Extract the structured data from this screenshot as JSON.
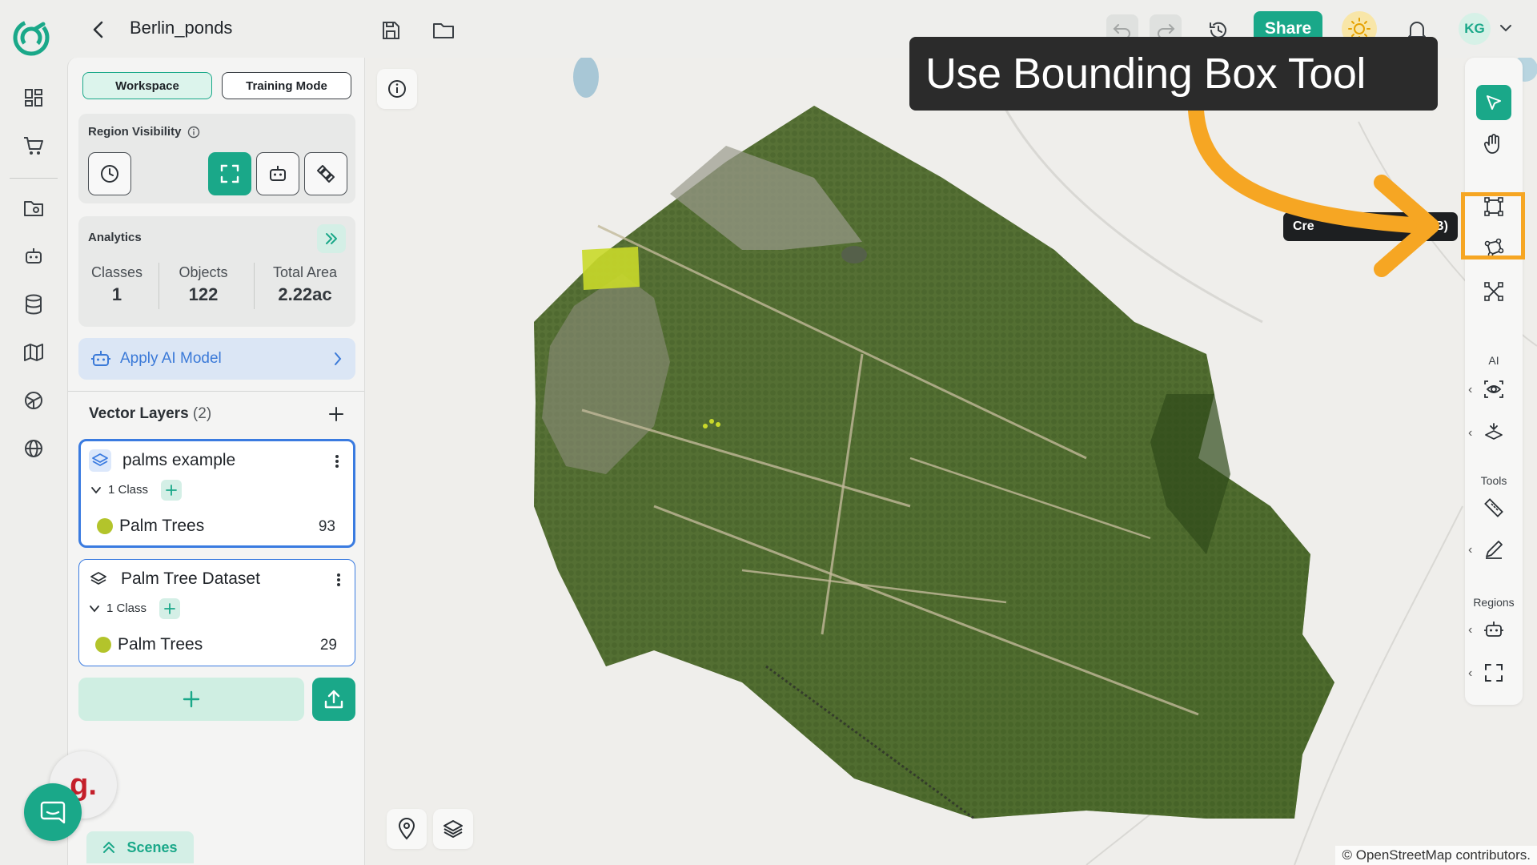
{
  "header": {
    "project_title": "Berlin_ponds",
    "share_label": "Share",
    "avatar_initials": "KG"
  },
  "colors": {
    "brand": "#1aa889",
    "highlight": "#f6a623",
    "layer_border": "#3a7be0",
    "class_dot": "#b3c42b"
  },
  "rail": {
    "items": [
      "dashboard-icon",
      "cart-icon",
      "folder-icon",
      "robot-icon",
      "database-icon",
      "map-icon",
      "globe-grid-icon",
      "globe-icon"
    ]
  },
  "panel": {
    "tabs": [
      {
        "label": "Workspace",
        "active": true
      },
      {
        "label": "Training Mode",
        "active": false
      }
    ],
    "region_visibility": {
      "title": "Region Visibility",
      "buttons": [
        "history-icon",
        "bounding-box-icon",
        "robot-icon",
        "satellite-icon"
      ]
    },
    "analytics": {
      "title": "Analytics",
      "stats": [
        {
          "label": "Classes",
          "value": "1"
        },
        {
          "label": "Objects",
          "value": "122"
        },
        {
          "label": "Total Area",
          "value": "2.22ac"
        }
      ]
    },
    "apply_ai": {
      "label": "Apply AI Model"
    },
    "vector_layers": {
      "title": "Vector Layers",
      "count": "(2)",
      "layers": [
        {
          "name": "palms example",
          "class_count_label": "1 Class",
          "classes": [
            {
              "name": "Palm Trees",
              "count": "93"
            }
          ]
        },
        {
          "name": "Palm Tree Dataset",
          "class_count_label": "1 Class",
          "classes": [
            {
              "name": "Palm Trees",
              "count": "29"
            }
          ]
        }
      ]
    },
    "scenes_label": "Scenes",
    "g_logo": "g."
  },
  "map": {
    "attribution": "© OpenStreetMap contributors."
  },
  "toolbar": {
    "groups": {
      "ai": "AI",
      "tools": "Tools",
      "regions": "Regions"
    },
    "tooltip_left": "Cre",
    "tooltip_right": "x (B)"
  },
  "callout": {
    "text": "Use Bounding Box Tool"
  }
}
